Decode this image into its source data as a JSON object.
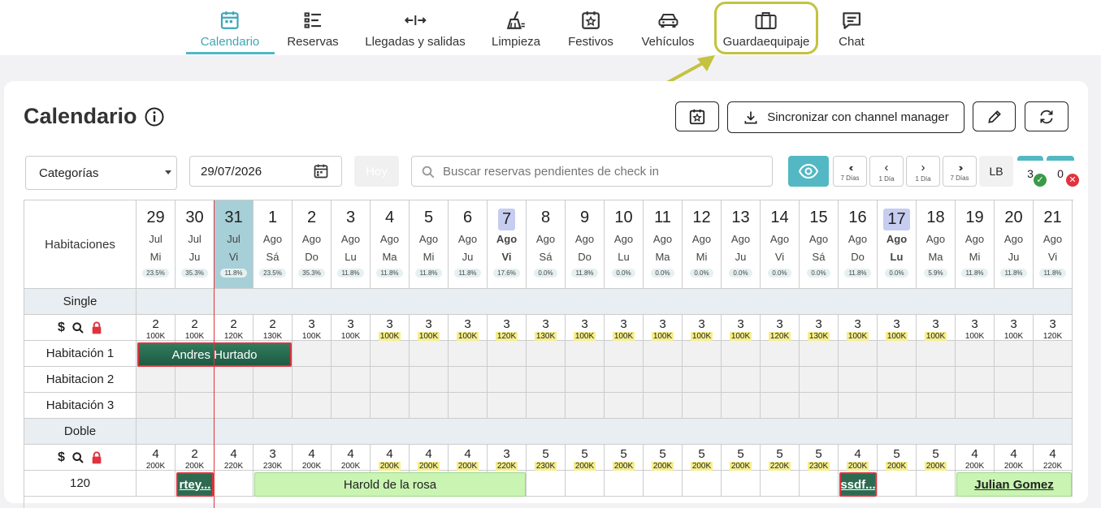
{
  "nav": {
    "items": [
      {
        "label": "Calendario",
        "icon": "calendar-icon",
        "active": true
      },
      {
        "label": "Reservas",
        "icon": "list-icon"
      },
      {
        "label": "Llegadas y salidas",
        "icon": "arrows-icon"
      },
      {
        "label": "Limpieza",
        "icon": "broom-icon"
      },
      {
        "label": "Festivos",
        "icon": "star-calendar-icon"
      },
      {
        "label": "Vehículos",
        "icon": "car-icon"
      },
      {
        "label": "Guardaequipaje",
        "icon": "luggage-icon"
      },
      {
        "label": "Chat",
        "icon": "chat-icon"
      }
    ]
  },
  "page": {
    "title": "Calendario"
  },
  "toolbar": {
    "sync_label": "Sincronizar con channel manager"
  },
  "filters": {
    "category_value": "Categorías",
    "date_value": "29/07/2026",
    "today_label": "Hoy",
    "search_placeholder": "Buscar reservas pendientes de check in",
    "nav": {
      "back7": "7 Días",
      "back1": "1 Día",
      "fwd1": "1 Día",
      "fwd7": "7 Días"
    },
    "lb_label": "LB",
    "ok_count": "3",
    "err_count": "0"
  },
  "grid": {
    "rooms_header": "Habitaciones",
    "days": [
      {
        "num": "29",
        "mon": "Jul",
        "dw": "Mi",
        "pct": "23.5%"
      },
      {
        "num": "30",
        "mon": "Jul",
        "dw": "Ju",
        "pct": "35.3%"
      },
      {
        "num": "31",
        "mon": "Jul",
        "dw": "Vi",
        "pct": "11.8%",
        "today": true
      },
      {
        "num": "1",
        "mon": "Ago",
        "dw": "Sá",
        "pct": "23.5%"
      },
      {
        "num": "2",
        "mon": "Ago",
        "dw": "Do",
        "pct": "35.3%"
      },
      {
        "num": "3",
        "mon": "Ago",
        "dw": "Lu",
        "pct": "11.8%"
      },
      {
        "num": "4",
        "mon": "Ago",
        "dw": "Ma",
        "pct": "11.8%"
      },
      {
        "num": "5",
        "mon": "Ago",
        "dw": "Mi",
        "pct": "11.8%"
      },
      {
        "num": "6",
        "mon": "Ago",
        "dw": "Ju",
        "pct": "11.8%"
      },
      {
        "num": "7",
        "mon": "Ago",
        "dw": "Vi",
        "pct": "17.6%",
        "holiday": true
      },
      {
        "num": "8",
        "mon": "Ago",
        "dw": "Sá",
        "pct": "0.0%"
      },
      {
        "num": "9",
        "mon": "Ago",
        "dw": "Do",
        "pct": "11.8%"
      },
      {
        "num": "10",
        "mon": "Ago",
        "dw": "Lu",
        "pct": "0.0%"
      },
      {
        "num": "11",
        "mon": "Ago",
        "dw": "Ma",
        "pct": "0.0%"
      },
      {
        "num": "12",
        "mon": "Ago",
        "dw": "Mi",
        "pct": "0.0%"
      },
      {
        "num": "13",
        "mon": "Ago",
        "dw": "Ju",
        "pct": "0.0%"
      },
      {
        "num": "14",
        "mon": "Ago",
        "dw": "Vi",
        "pct": "0.0%"
      },
      {
        "num": "15",
        "mon": "Ago",
        "dw": "Sá",
        "pct": "0.0%"
      },
      {
        "num": "16",
        "mon": "Ago",
        "dw": "Do",
        "pct": "11.8%"
      },
      {
        "num": "17",
        "mon": "Ago",
        "dw": "Lu",
        "pct": "0.0%",
        "holiday": true
      },
      {
        "num": "18",
        "mon": "Ago",
        "dw": "Ma",
        "pct": "5.9%"
      },
      {
        "num": "19",
        "mon": "Ago",
        "dw": "Mi",
        "pct": "11.8%"
      },
      {
        "num": "20",
        "mon": "Ago",
        "dw": "Ju",
        "pct": "11.8%"
      },
      {
        "num": "21",
        "mon": "Ago",
        "dw": "Vi",
        "pct": "11.8%"
      }
    ],
    "categories": [
      {
        "name": "Single",
        "availability": [
          {
            "n": "2",
            "p": "100K",
            "y": false
          },
          {
            "n": "2",
            "p": "100K",
            "y": false
          },
          {
            "n": "2",
            "p": "120K",
            "y": false
          },
          {
            "n": "2",
            "p": "130K",
            "y": false
          },
          {
            "n": "3",
            "p": "100K",
            "y": false
          },
          {
            "n": "3",
            "p": "100K",
            "y": false
          },
          {
            "n": "3",
            "p": "100K",
            "y": true
          },
          {
            "n": "3",
            "p": "100K",
            "y": true
          },
          {
            "n": "3",
            "p": "100K",
            "y": true
          },
          {
            "n": "3",
            "p": "120K",
            "y": true
          },
          {
            "n": "3",
            "p": "130K",
            "y": true
          },
          {
            "n": "3",
            "p": "100K",
            "y": true
          },
          {
            "n": "3",
            "p": "100K",
            "y": true
          },
          {
            "n": "3",
            "p": "100K",
            "y": true
          },
          {
            "n": "3",
            "p": "100K",
            "y": true
          },
          {
            "n": "3",
            "p": "100K",
            "y": true
          },
          {
            "n": "3",
            "p": "120K",
            "y": true
          },
          {
            "n": "3",
            "p": "130K",
            "y": true
          },
          {
            "n": "3",
            "p": "100K",
            "y": true
          },
          {
            "n": "3",
            "p": "100K",
            "y": true
          },
          {
            "n": "3",
            "p": "100K",
            "y": true
          },
          {
            "n": "3",
            "p": "100K",
            "y": false
          },
          {
            "n": "3",
            "p": "100K",
            "y": false
          },
          {
            "n": "3",
            "p": "120K",
            "y": false
          }
        ],
        "rooms": [
          {
            "name": "Habitación 1",
            "reservations": [
              {
                "guest": "Andres Hurtado",
                "start": 0,
                "span": 4,
                "style": "dark"
              }
            ]
          },
          {
            "name": "Habitacion 2",
            "reservations": []
          },
          {
            "name": "Habitación 3",
            "reservations": []
          }
        ]
      },
      {
        "name": "Doble",
        "availability": [
          {
            "n": "4",
            "p": "200K",
            "y": false
          },
          {
            "n": "2",
            "p": "200K",
            "y": false
          },
          {
            "n": "4",
            "p": "220K",
            "y": false
          },
          {
            "n": "3",
            "p": "230K",
            "y": false
          },
          {
            "n": "4",
            "p": "200K",
            "y": false
          },
          {
            "n": "4",
            "p": "200K",
            "y": false
          },
          {
            "n": "4",
            "p": "200K",
            "y": true
          },
          {
            "n": "4",
            "p": "200K",
            "y": true
          },
          {
            "n": "4",
            "p": "200K",
            "y": true
          },
          {
            "n": "3",
            "p": "220K",
            "y": true
          },
          {
            "n": "5",
            "p": "230K",
            "y": true
          },
          {
            "n": "5",
            "p": "200K",
            "y": true
          },
          {
            "n": "5",
            "p": "200K",
            "y": true
          },
          {
            "n": "5",
            "p": "200K",
            "y": true
          },
          {
            "n": "5",
            "p": "200K",
            "y": true
          },
          {
            "n": "5",
            "p": "200K",
            "y": true
          },
          {
            "n": "5",
            "p": "220K",
            "y": true
          },
          {
            "n": "5",
            "p": "230K",
            "y": true
          },
          {
            "n": "4",
            "p": "200K",
            "y": true
          },
          {
            "n": "5",
            "p": "200K",
            "y": true
          },
          {
            "n": "5",
            "p": "200K",
            "y": true
          },
          {
            "n": "4",
            "p": "200K",
            "y": false
          },
          {
            "n": "4",
            "p": "200K",
            "y": false
          },
          {
            "n": "4",
            "p": "220K",
            "y": false
          }
        ],
        "rooms": [
          {
            "name": "120",
            "reservations": [
              {
                "guest": "rtey...",
                "start": 1,
                "span": 1,
                "style": "dark-underline"
              },
              {
                "guest": "Harold de la rosa",
                "start": 3,
                "span": 7,
                "style": "light"
              },
              {
                "guest": "ssdf...",
                "start": 18,
                "span": 1,
                "style": "dark-underline"
              },
              {
                "guest": "Julian Gomez",
                "start": 21,
                "span": 3,
                "style": "light-underline"
              }
            ]
          }
        ]
      }
    ]
  },
  "colors": {
    "accent": "#53b8c3",
    "highlight": "#c3c341",
    "dark_reservation": "#2d6b51",
    "light_reservation": "#c9f4b2",
    "yellow_price": "#f5ee8f",
    "today_column": "#a6cfd7",
    "holiday_box": "#c7cdf0"
  }
}
